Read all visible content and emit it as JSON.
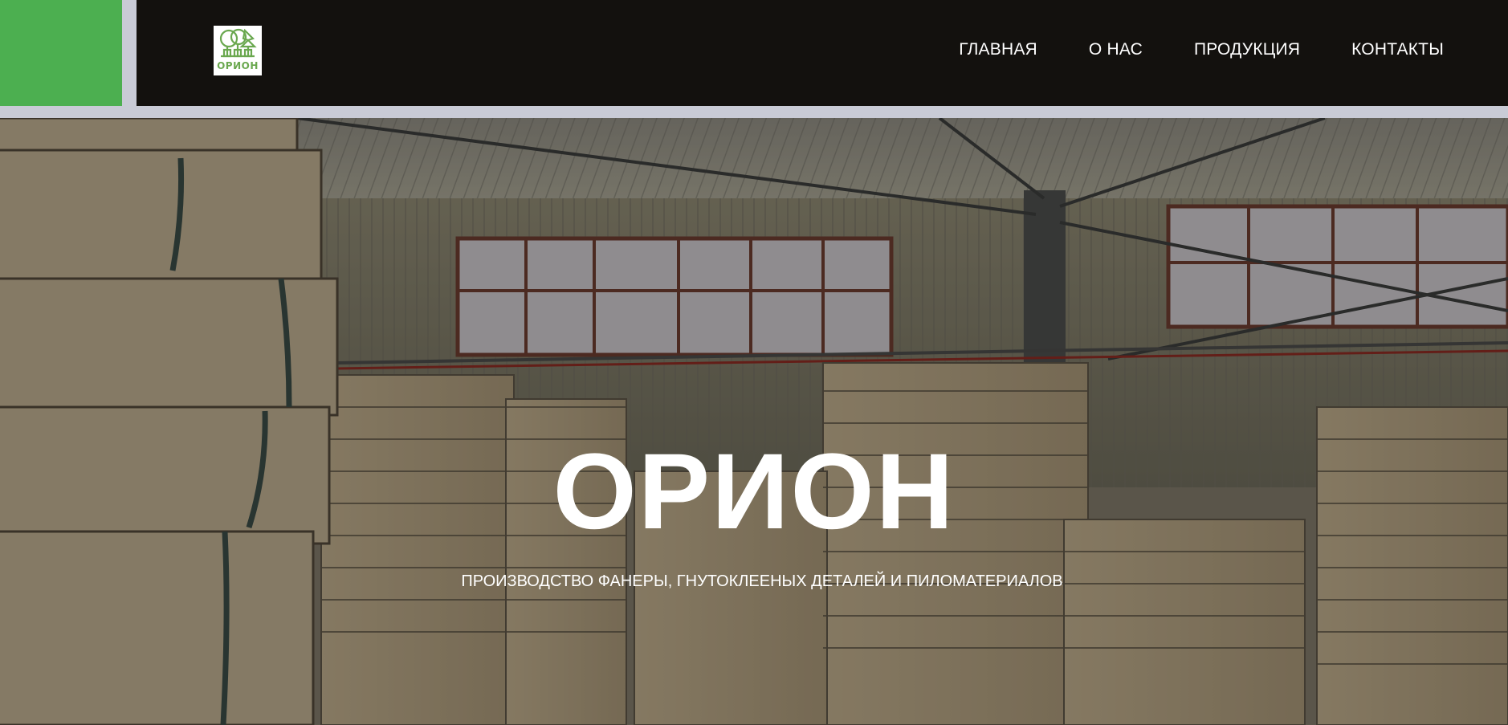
{
  "header": {
    "logo": {
      "text": "ОРИОН",
      "icon": "trees-logo-icon",
      "color": "#6aa84f"
    },
    "accent_color": "#4caf50",
    "nav": [
      {
        "label": "ГЛАВНАЯ"
      },
      {
        "label": "О НАС"
      },
      {
        "label": "ПРОДУКЦИЯ"
      },
      {
        "label": "КОНТАКТЫ"
      }
    ]
  },
  "hero": {
    "title": "ОРИОН",
    "subtitle": "ПРОИЗВОДСТВО ФАНЕРЫ, ГНУТОКЛЕЕНЫХ ДЕТАЛЕЙ И ПИЛОМАТЕРИАЛОВ",
    "background": "warehouse-plywood-stacks-photo"
  }
}
